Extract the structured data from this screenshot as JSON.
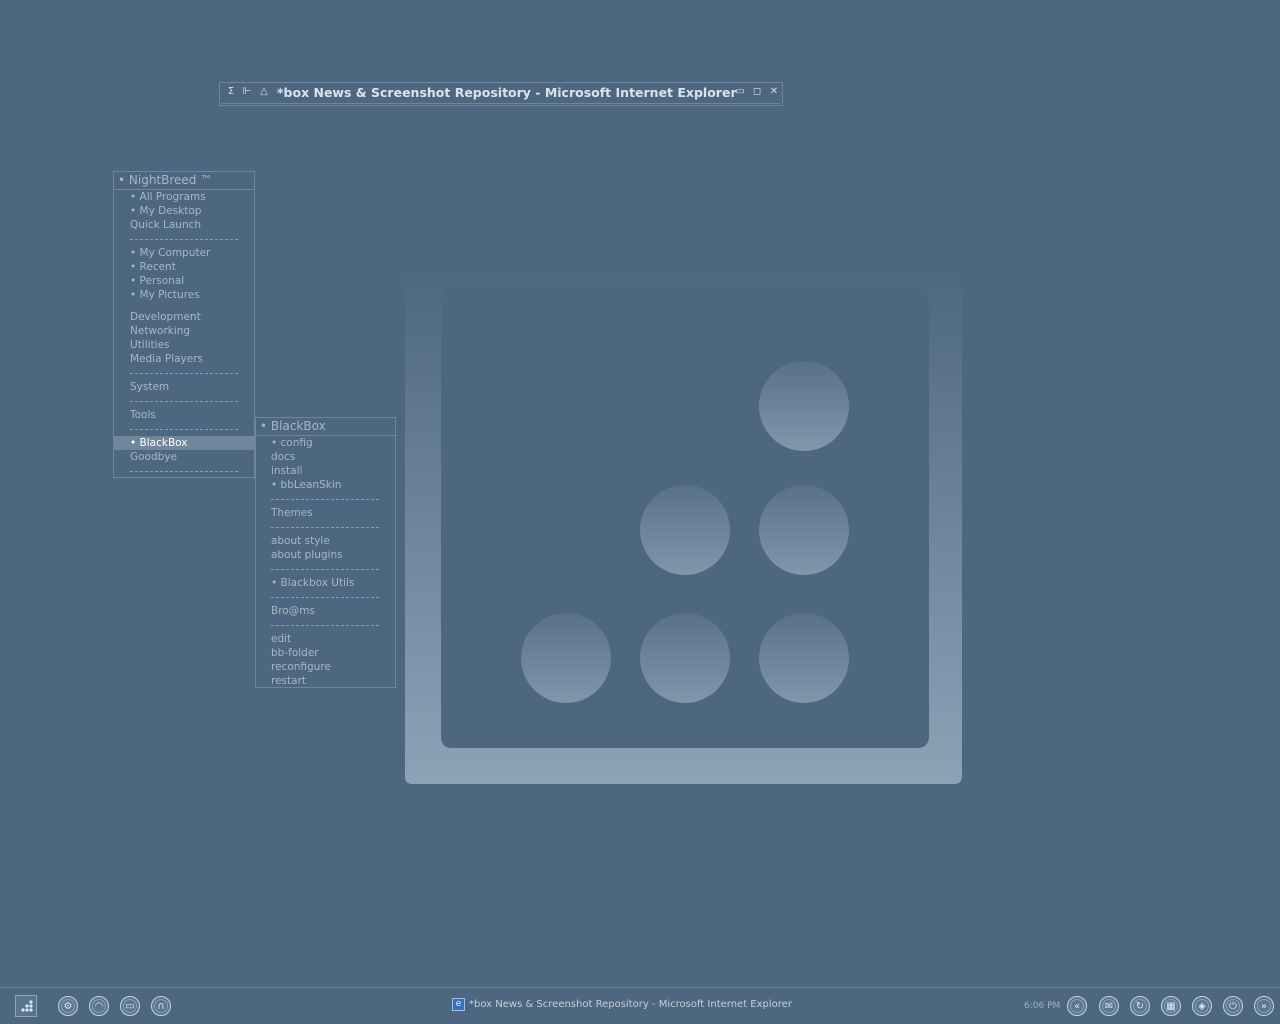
{
  "window": {
    "title": "*box News & Screenshot Repository - Microsoft Internet Explorer",
    "left_buttons": [
      "sigma-icon",
      "pin-icon",
      "shade-icon"
    ],
    "right_buttons": [
      "minimize-icon",
      "maximize-icon",
      "close-icon"
    ]
  },
  "root_menu": {
    "title": "• NightBreed ™",
    "items": [
      {
        "label": "• All Programs"
      },
      {
        "label": "• My Desktop"
      },
      {
        "label": "Quick Launch"
      },
      {
        "label": "• My Computer"
      },
      {
        "label": "• Recent"
      },
      {
        "label": "• Personal"
      },
      {
        "label": "• My Pictures"
      },
      {
        "label": "Development"
      },
      {
        "label": "Networking"
      },
      {
        "label": "Utilities"
      },
      {
        "label": "Media Players"
      },
      {
        "label": "System"
      },
      {
        "label": "Tools"
      },
      {
        "label": "• BlackBox",
        "active": true
      },
      {
        "label": "Goodbye"
      }
    ]
  },
  "blackbox_menu": {
    "title": "• BlackBox",
    "items": [
      {
        "label": "• config"
      },
      {
        "label": "docs"
      },
      {
        "label": "install"
      },
      {
        "label": "• bbLeanSkin"
      },
      {
        "label": "Themes"
      },
      {
        "label": "about style"
      },
      {
        "label": "about plugins"
      },
      {
        "label": "• Blackbox Utils"
      },
      {
        "label": "Bro@ms"
      },
      {
        "label": "edit"
      },
      {
        "label": "bb-folder"
      },
      {
        "label": "reconfigure"
      },
      {
        "label": "restart"
      }
    ]
  },
  "taskbar": {
    "start_icon": "blackbox-dots-icon",
    "left_buttons": [
      "gear-icon",
      "circle-icon",
      "monitor-icon",
      "headphones-icon"
    ],
    "task_title": "*box News & Screenshot Repository - Microsoft Internet Explorer",
    "task_icon": "internet-explorer-icon",
    "clock": "6:06 PM",
    "right_buttons": [
      "rewind-icon",
      "mail-icon",
      "refresh-icon",
      "calendar-icon",
      "compass-icon",
      "power-icon",
      "forward-icon"
    ]
  },
  "colors": {
    "desktop": "#4d6780",
    "menu_border": "#6f859b",
    "menu_text": "#a7b6c5",
    "active_item": "#6f869d",
    "logo_gradient_top": "#4d6780",
    "logo_gradient_bottom": "#8ea2b7"
  }
}
